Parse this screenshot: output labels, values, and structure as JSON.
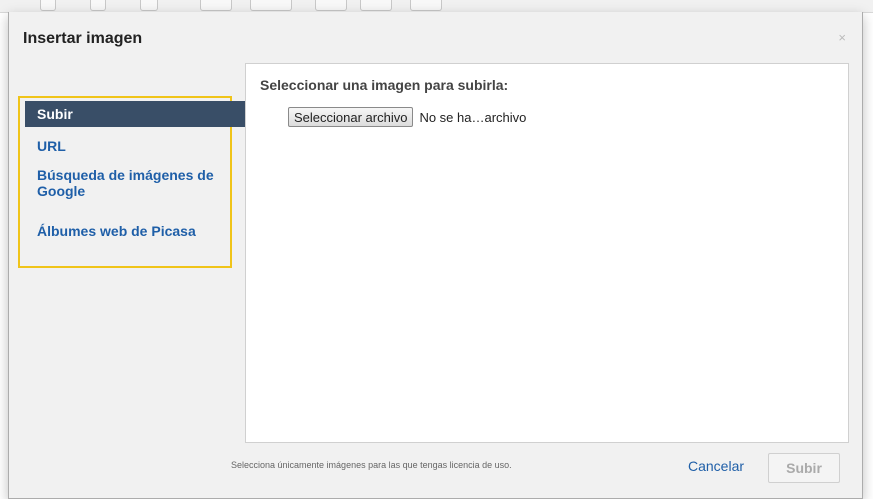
{
  "dialog": {
    "title": "Insertar imagen",
    "close_glyph": "×"
  },
  "sidebar": {
    "items": [
      {
        "label": "Subir",
        "active": true
      },
      {
        "label": "URL",
        "active": false
      },
      {
        "label": "Búsqueda de imágenes de Google",
        "active": false
      },
      {
        "label": "Álbumes web de Picasa",
        "active": false
      }
    ]
  },
  "upload": {
    "heading": "Seleccionar una imagen para subirla:",
    "choose_button": "Seleccionar archivo",
    "file_status": "No se ha…archivo"
  },
  "footer": {
    "note": "Selecciona únicamente imágenes para las que tengas licencia de uso.",
    "cancel_label": "Cancelar",
    "submit_label": "Subir"
  },
  "colors": {
    "active_nav_bg": "#394e67",
    "link": "#1f5fa8",
    "highlight_border": "#f0c419"
  }
}
